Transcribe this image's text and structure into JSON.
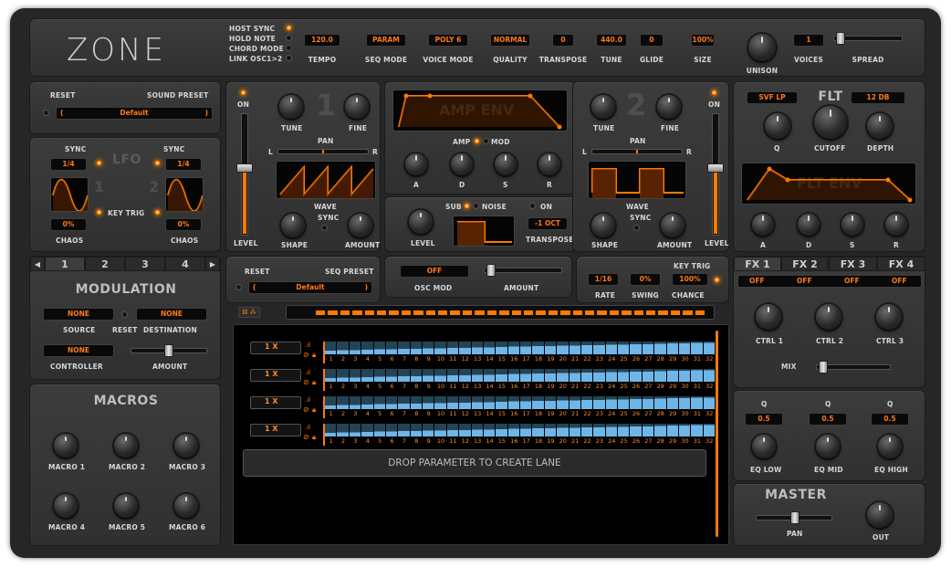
{
  "app": {
    "logo": "ZONE"
  },
  "header": {
    "toggles": [
      {
        "label": "HOST SYNC",
        "on": true
      },
      {
        "label": "HOLD NOTE",
        "on": false
      },
      {
        "label": "CHORD MODE",
        "on": false
      },
      {
        "label": "LINK OSC1>2",
        "on": false
      }
    ],
    "params": [
      {
        "label": "TEMPO",
        "value": "120.0"
      },
      {
        "label": "SEQ MODE",
        "value": "PARAM"
      },
      {
        "label": "VOICE MODE",
        "value": "POLY 6"
      },
      {
        "label": "QUALITY",
        "value": "NORMAL"
      },
      {
        "label": "TRANSPOSE",
        "value": "0"
      },
      {
        "label": "TUNE",
        "value": "440.0"
      },
      {
        "label": "GLIDE",
        "value": "0"
      },
      {
        "label": "SIZE",
        "value": "100%"
      }
    ],
    "unison_label": "UNISON",
    "voices_label": "VOICES",
    "voices_value": "1",
    "spread_label": "SPREAD"
  },
  "sound_preset": {
    "reset_label": "RESET",
    "title": "SOUND PRESET",
    "value": "Default",
    "prev": "(",
    "next": ")"
  },
  "lfo": {
    "title": "LFO",
    "sync_label": "SYNC",
    "rate1": "1/4",
    "rate2": "1/4",
    "num1": "1",
    "num2": "2",
    "keytrig_label": "KEY TRIG",
    "chaos_label": "CHAOS",
    "chaos1": "0%",
    "chaos2": "0%"
  },
  "osc1": {
    "number": "1",
    "on_label": "ON",
    "tune_label": "TUNE",
    "fine_label": "FINE",
    "pan_label": "PAN",
    "pan_l": "L",
    "pan_r": "R",
    "wave_label": "WAVE",
    "level_label": "LEVEL",
    "shape_label": "SHAPE",
    "sync_label": "SYNC",
    "amount_label": "AMOUNT"
  },
  "osc2": {
    "number": "2",
    "on_label": "ON",
    "tune_label": "TUNE",
    "fine_label": "FINE",
    "pan_label": "PAN",
    "pan_l": "L",
    "pan_r": "R",
    "wave_label": "WAVE",
    "level_label": "LEVEL",
    "shape_label": "SHAPE",
    "sync_label": "SYNC",
    "amount_label": "AMOUNT"
  },
  "amp_env": {
    "title": "AMP ENV",
    "amp_label": "AMP",
    "mod_label": "MOD",
    "a": "A",
    "d": "D",
    "s": "S",
    "r": "R"
  },
  "sub": {
    "sub_label": "SUB",
    "noise_label": "NOISE",
    "on_label": "ON",
    "level_label": "LEVEL",
    "transpose_label": "TRANSPOSE",
    "transpose_value": "-1 OCT"
  },
  "osc_mod": {
    "value": "OFF",
    "label": "OSC MOD",
    "amount_label": "AMOUNT"
  },
  "filter": {
    "type": "SVF LP",
    "title": "FLT",
    "slope": "12 DB",
    "q_label": "Q",
    "cutoff_label": "CUTOFF",
    "depth_label": "DEPTH",
    "env_title": "FLT ENV",
    "a": "A",
    "d": "D",
    "s": "S",
    "r": "R"
  },
  "modulation": {
    "tabs": [
      "1",
      "2",
      "3",
      "4"
    ],
    "prev": "◀",
    "next": "▶",
    "title": "MODULATION",
    "source_value": "NONE",
    "source_label": "SOURCE",
    "reset_label": "RESET",
    "dest_value": "NONE",
    "dest_label": "DESTINATION",
    "controller_value": "NONE",
    "controller_label": "CONTROLLER",
    "amount_label": "AMOUNT"
  },
  "macros": {
    "title": "MACROS",
    "labels": [
      "MACRO 1",
      "MACRO 2",
      "MACRO 3",
      "MACRO 4",
      "MACRO 5",
      "MACRO 6"
    ]
  },
  "seq": {
    "reset_label": "RESET",
    "preset_title": "SEQ PRESET",
    "preset_value": "Default",
    "prev": "(",
    "next": ")",
    "rate_label": "RATE",
    "rate_value": "1/16",
    "swing_label": "SWING",
    "swing_value": "0%",
    "chance_label": "CHANCE",
    "chance_value": "100%",
    "keytrig_label": "KEY TRIG",
    "lanes": [
      {
        "mult": "1 X"
      },
      {
        "mult": "1 X"
      },
      {
        "mult": "1 X"
      },
      {
        "mult": "1 X"
      }
    ],
    "steps": [
      "1",
      "2",
      "3",
      "4",
      "5",
      "6",
      "7",
      "8",
      "9",
      "10",
      "11",
      "12",
      "13",
      "14",
      "15",
      "16",
      "17",
      "18",
      "19",
      "20",
      "21",
      "22",
      "23",
      "24",
      "25",
      "26",
      "27",
      "28",
      "29",
      "30",
      "31",
      "32"
    ],
    "drop_text": "DROP PARAMETER TO CREATE LANE"
  },
  "fx": {
    "tabs": [
      "FX 1",
      "FX 2",
      "FX 3",
      "FX 4"
    ],
    "states": [
      "OFF",
      "OFF",
      "OFF",
      "OFF"
    ],
    "ctrl_labels": [
      "CTRL 1",
      "CTRL 2",
      "CTRL 3"
    ],
    "mix_label": "MIX"
  },
  "eq": {
    "q_label": "Q",
    "q_values": [
      "0.5",
      "0.5",
      "0.5"
    ],
    "labels": [
      "EQ LOW",
      "EQ MID",
      "EQ HIGH"
    ]
  },
  "master": {
    "title": "MASTER",
    "pan_label": "PAN",
    "out_label": "OUT"
  },
  "colors": {
    "accent": "#ff7a00",
    "step_blue": "#6fb6e8",
    "panel": "#363636"
  }
}
